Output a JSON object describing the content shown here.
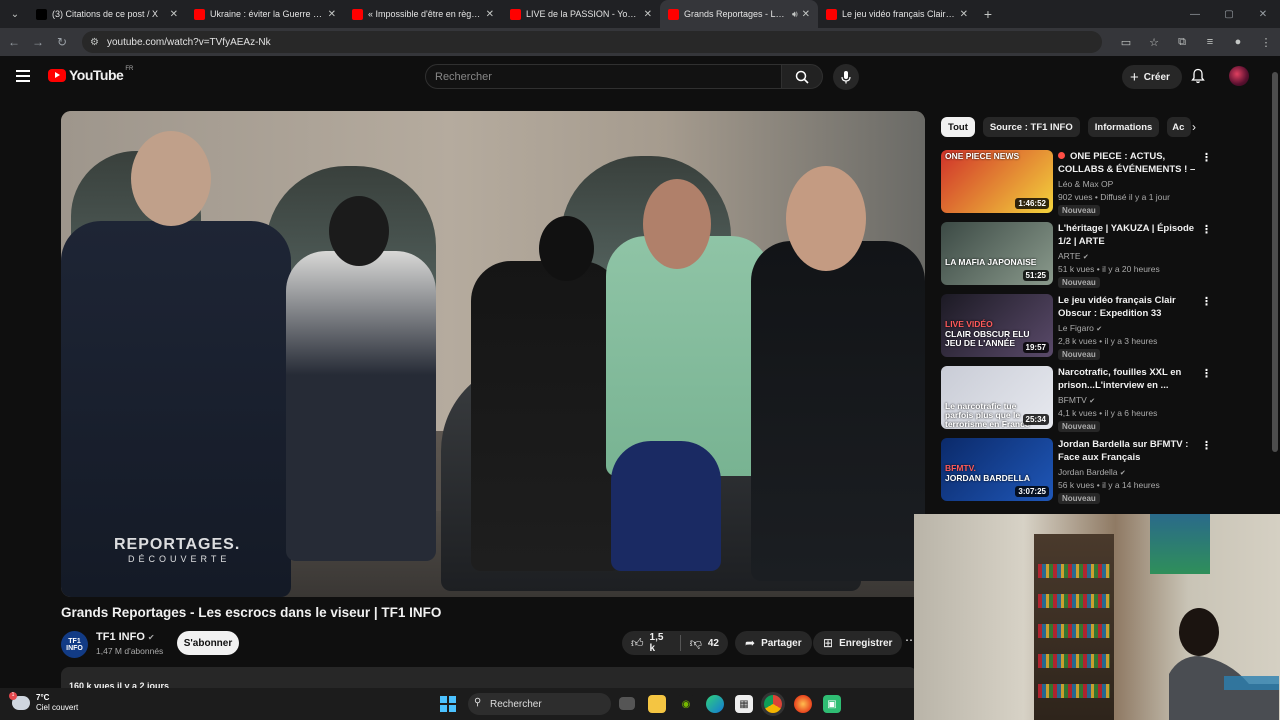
{
  "browser": {
    "tabs": [
      {
        "title": "(3) Citations de ce post / X",
        "favicon": "x-logo",
        "color": "#000000",
        "active": false
      },
      {
        "title": "Ukraine : éviter la Guerre mondi",
        "favicon": "youtube-logo",
        "color": "#ff0000",
        "active": false
      },
      {
        "title": "« Impossible d'être en règle ! »",
        "favicon": "youtube-logo",
        "color": "#ff0000",
        "active": false
      },
      {
        "title": "LIVE de la PASSION - YouTube",
        "favicon": "youtube-logo",
        "color": "#ff0000",
        "active": false
      },
      {
        "title": "Grands Reportages - Les es",
        "favicon": "youtube-logo",
        "color": "#ff0000",
        "active": true,
        "audio": true
      },
      {
        "title": "Le jeu vidéo français Clair Obsc",
        "favicon": "youtube-logo",
        "color": "#ff0000",
        "active": false
      }
    ],
    "url": "youtube.com/watch?v=TVfyAEAz-Nk"
  },
  "header": {
    "logo_text": "YouTube",
    "country_code": "FR",
    "search_placeholder": "Rechercher",
    "create_label": "Créer"
  },
  "video": {
    "title": "Grands Reportages - Les escrocs dans le viseur | TF1 INFO",
    "watermark_main": "REPORTAGES.",
    "watermark_sub": "DÉCOUVERTE",
    "channel_name": "TF1 INFO",
    "channel_avatar_text": "TF1 INFO",
    "subscribers": "1,47 M d'abonnés",
    "subscribe_label": "S'abonner",
    "likes": "1,5 k",
    "dislikes": "42",
    "share_label": "Partager",
    "save_label": "Enregistrer",
    "description_preview": "160 k vues  il y a 2 jours"
  },
  "chips": [
    "Tout",
    "Source : TF1 INFO",
    "Informations",
    "Ac"
  ],
  "recommendations": [
    {
      "title": "ONE PIECE : ACTUS, COLLABS & ÉVÉNEMENTS ! – ...",
      "live": true,
      "channel": "Léo & Max OP",
      "verified": false,
      "meta": "902 vues • Diffusé il y a 1 jour",
      "badge": "Nouveau",
      "duration": "1:46:52",
      "caption": "ONE PIECE NEWS",
      "thumb_colors": [
        "#d0322a",
        "#f4d43c"
      ]
    },
    {
      "title": "L'héritage | YAKUZA | Épisode 1/2 | ARTE",
      "live": false,
      "channel": "ARTE",
      "verified": true,
      "meta": "51 k vues • il y a 20 heures",
      "badge": "Nouveau",
      "duration": "51:25",
      "caption": "LA MAFIA JAPONAISE",
      "thumb_colors": [
        "#3c4a45",
        "#8a9a8c"
      ]
    },
    {
      "title": "Le jeu vidéo français Clair Obscur : Expedition 33 triomp...",
      "live": false,
      "channel": "Le Figaro",
      "verified": true,
      "meta": "2,8 k vues • il y a 3 heures",
      "badge": "Nouveau",
      "duration": "19:57",
      "caption": "CLAIR OBSCUR ELU JEU DE L'ANNÉE",
      "caption_tag": "LIVE VIDÉO",
      "thumb_colors": [
        "#1c1a24",
        "#5a4a6a"
      ]
    },
    {
      "title": "Narcotrafic, fouilles XXL en prison...L'interview en ...",
      "live": false,
      "channel": "BFMTV",
      "verified": true,
      "meta": "4,1 k vues • il y a 6 heures",
      "badge": "Nouveau",
      "duration": "25:34",
      "caption": "Le narcotrafic tue parfois plus que le terrorisme en France",
      "thumb_colors": [
        "#c9ccd6",
        "#e7e9ef"
      ]
    },
    {
      "title": "Jordan Bardella sur BFMTV : Face aux Français",
      "live": false,
      "channel": "Jordan Bardella",
      "verified": true,
      "meta": "56 k vues • il y a 14 heures",
      "badge": "Nouveau",
      "duration": "3:07:25",
      "caption": "JORDAN BARDELLA",
      "caption_tag": "BFMTV.",
      "thumb_colors": [
        "#0b2a6a",
        "#1f57b8"
      ]
    }
  ],
  "taskbar": {
    "temperature": "7°C",
    "weather": "Ciel couvert",
    "weather_badge": "1",
    "search_label": "Rechercher"
  }
}
